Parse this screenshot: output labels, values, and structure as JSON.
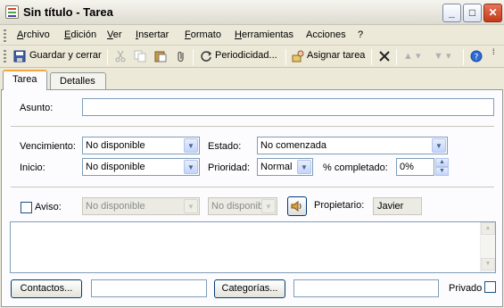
{
  "window": {
    "title": "Sin título - Tarea"
  },
  "menu": [
    "Archivo",
    "Edición",
    "Ver",
    "Insertar",
    "Formato",
    "Herramientas",
    "Acciones",
    "?"
  ],
  "toolbar": {
    "save_close": "Guardar y cerrar",
    "recurrence": "Periodicidad...",
    "assign": "Asignar tarea"
  },
  "tabs": [
    "Tarea",
    "Detalles"
  ],
  "form": {
    "subject_label": "Asunto:",
    "subject_value": "",
    "due_label": "Vencimiento:",
    "due_value": "No disponible",
    "start_label": "Inicio:",
    "start_value": "No disponible",
    "status_label": "Estado:",
    "status_value": "No comenzada",
    "priority_label": "Prioridad:",
    "priority_value": "Normal",
    "percent_label": "% completado:",
    "percent_value": "0%",
    "reminder_label": "Aviso:",
    "reminder_date": "No disponible",
    "reminder_time": "No disponib",
    "owner_label": "Propietario:",
    "owner_value": "Javier",
    "contacts_button": "Contactos...",
    "categories_button": "Categorías...",
    "private_label": "Privado"
  }
}
